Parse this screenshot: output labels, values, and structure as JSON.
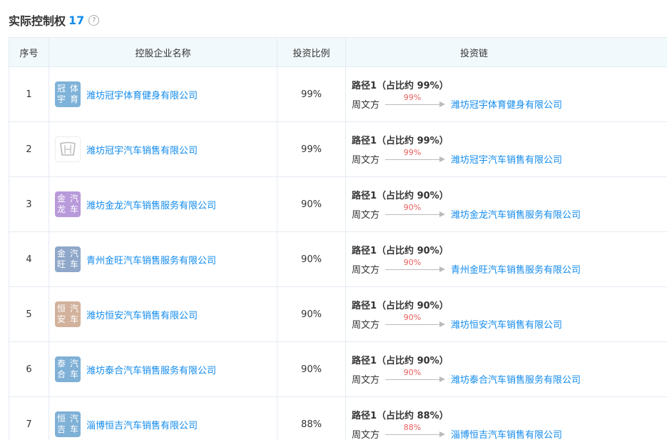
{
  "header": {
    "title": "实际控制权",
    "count": "17"
  },
  "columns": [
    "序号",
    "控股企业名称",
    "投资比例",
    "投资链"
  ],
  "rows": [
    {
      "index": "1",
      "logo_text": "冠宇\n体育",
      "logo_color": "#7eb2d8",
      "company": "潍坊冠宇体育健身有限公司",
      "ratio": "99%",
      "path_label": "路径1（占比约 99%）",
      "person": "周文方",
      "chain_pct": "99%",
      "target": "潍坊冠宇体育健身有限公司"
    },
    {
      "index": "2",
      "logo_text": "",
      "logo_color": "#ffffff",
      "company": "潍坊冠宇汽车销售有限公司",
      "ratio": "99%",
      "path_label": "路径1（占比约 99%）",
      "person": "周文方",
      "chain_pct": "99%",
      "target": "潍坊冠宇汽车销售有限公司"
    },
    {
      "index": "3",
      "logo_text": "金龙\n汽车",
      "logo_color": "#b89ada",
      "company": "潍坊金龙汽车销售服务有限公司",
      "ratio": "90%",
      "path_label": "路径1（占比约 90%）",
      "person": "周文方",
      "chain_pct": "90%",
      "target": "潍坊金龙汽车销售服务有限公司"
    },
    {
      "index": "4",
      "logo_text": "金旺\n汽车",
      "logo_color": "#8fa7c9",
      "company": "青州金旺汽车销售服务有限公司",
      "ratio": "90%",
      "path_label": "路径1（占比约 90%）",
      "person": "周文方",
      "chain_pct": "90%",
      "target": "青州金旺汽车销售服务有限公司"
    },
    {
      "index": "5",
      "logo_text": "恒安\n汽车",
      "logo_color": "#d2b29c",
      "company": "潍坊恒安汽车销售有限公司",
      "ratio": "90%",
      "path_label": "路径1（占比约 90%）",
      "person": "周文方",
      "chain_pct": "90%",
      "target": "潍坊恒安汽车销售有限公司"
    },
    {
      "index": "6",
      "logo_text": "泰合\n汽车",
      "logo_color": "#7fb0d6",
      "company": "潍坊泰合汽车销售服务有限公司",
      "ratio": "90%",
      "path_label": "路径1（占比约 90%）",
      "person": "周文方",
      "chain_pct": "90%",
      "target": "潍坊泰合汽车销售服务有限公司"
    },
    {
      "index": "7",
      "logo_text": "恒吉\n汽车",
      "logo_color": "#7fb0d6",
      "company": "淄博恒吉汽车销售有限公司",
      "ratio": "88%",
      "path_label": "路径1（占比约 88%）",
      "person": "周文方",
      "chain_pct": "88%",
      "target": "淄博恒吉汽车销售有限公司"
    }
  ]
}
